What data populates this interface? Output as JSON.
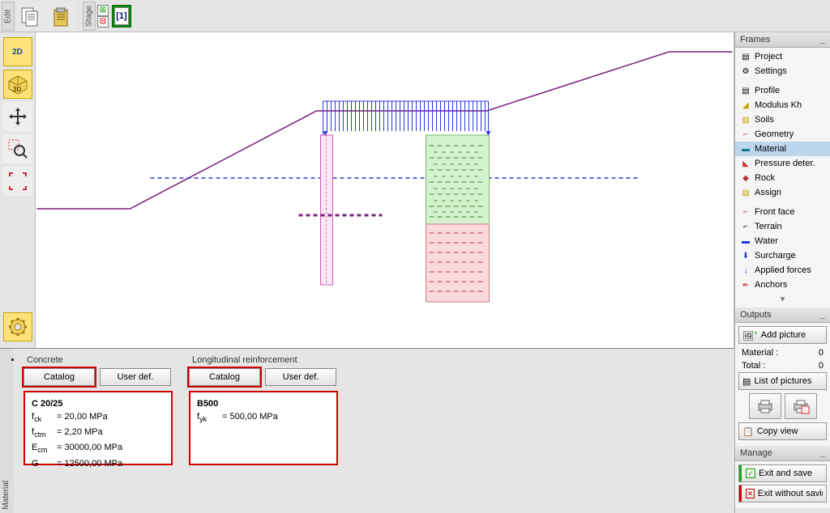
{
  "top": {
    "edit_label": "Edit",
    "stage_label": "Stage",
    "stage_number": "[1]"
  },
  "left": {
    "btn_2d": "2D",
    "btn_3d": "3D"
  },
  "frames": {
    "header": "Frames",
    "items": [
      {
        "label": "Project"
      },
      {
        "label": "Settings"
      },
      {
        "label": "Profile"
      },
      {
        "label": "Modulus Kh"
      },
      {
        "label": "Soils"
      },
      {
        "label": "Geometry"
      },
      {
        "label": "Material"
      },
      {
        "label": "Pressure deter."
      },
      {
        "label": "Rock"
      },
      {
        "label": "Assign"
      },
      {
        "label": "Front face"
      },
      {
        "label": "Terrain"
      },
      {
        "label": "Water"
      },
      {
        "label": "Surcharge"
      },
      {
        "label": "Applied forces"
      },
      {
        "label": "Anchors"
      }
    ]
  },
  "outputs": {
    "header": "Outputs",
    "add_picture": "Add picture",
    "material_label": "Material :",
    "material_value": "0",
    "total_label": "Total :",
    "total_value": "0",
    "list_pictures": "List of pictures",
    "copy_view": "Copy view"
  },
  "manage": {
    "header": "Manage",
    "exit_save": "Exit and save",
    "exit_nosave": "Exit without saving"
  },
  "bottom": {
    "tab_label": "Material",
    "concrete": {
      "title": "Concrete",
      "catalog": "Catalog",
      "userdef": "User def.",
      "name": "C 20/25",
      "fck_label": "fck",
      "fck": "20,00 MPa",
      "fctm_label": "fctm",
      "fctm": "2,20 MPa",
      "ecm_label": "Ecm",
      "ecm": "30000,00 MPa",
      "g_label": "G",
      "g": "12500,00 MPa"
    },
    "reinforcement": {
      "title": "Longitudinal reinforcement",
      "catalog": "Catalog",
      "userdef": "User def.",
      "name": "B500",
      "fyk_label": "fyk",
      "fyk": "500,00 MPa"
    }
  }
}
